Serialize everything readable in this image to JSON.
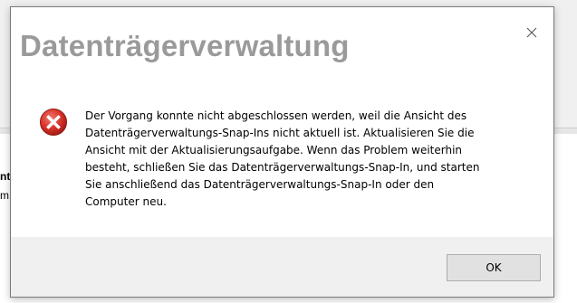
{
  "dialog": {
    "title": "Datenträgerverwaltung",
    "message": "Der Vorgang konnte nicht abgeschlossen werden, weil die Ansicht des\nDatenträgerverwaltungs-Snap-Ins nicht aktuell ist. Aktualisieren Sie die\nAnsicht mit der Aktualisierungsaufgabe. Wenn das Problem weiterhin\nbesteht, schließen Sie das Datenträgerverwaltungs-Snap-In, und starten\nSie anschließend das Datenträgerverwaltungs-Snap-In oder den\nComputer neu.",
    "ok_label": "OK",
    "icon": "error-icon"
  },
  "background": {
    "line1": "nt",
    "line2": "m"
  },
  "colors": {
    "error_red": "#d9342b",
    "title_gray": "#9a9a9a",
    "footer_bg": "#f0f0f0"
  }
}
